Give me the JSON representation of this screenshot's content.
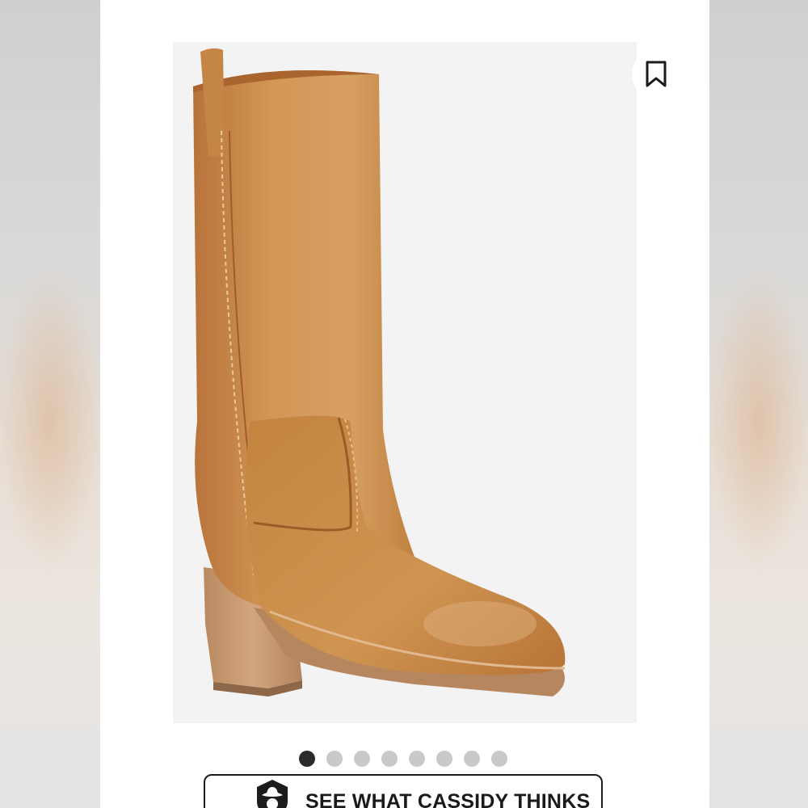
{
  "product": {
    "image_alt": "Tan leather pull-on boot with stacked block heel"
  },
  "carousel": {
    "total": 8,
    "active_index": 0
  },
  "cta": {
    "label": "SEE WHAT CASSIDY THINKS",
    "icon": "cowboy-hat-assistant-icon"
  },
  "bookmark": {
    "icon": "bookmark-icon"
  },
  "colors": {
    "leather": "#c98b4c",
    "heel": "#c79a72",
    "active_dot": "#2b2b2b",
    "inactive_dot": "#c9c9c9"
  }
}
